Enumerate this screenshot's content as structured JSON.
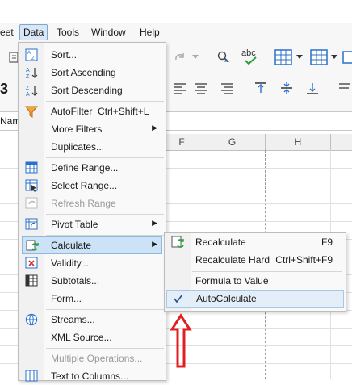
{
  "menubar": {
    "items": [
      {
        "label": "eet"
      },
      {
        "label": "Data"
      },
      {
        "label": "Tools"
      },
      {
        "label": "Window"
      },
      {
        "label": "Help"
      }
    ]
  },
  "namebox": {
    "label": "Nam"
  },
  "toolbar": {
    "digit": "3"
  },
  "columns": [
    "F",
    "G",
    "H"
  ],
  "data_menu": {
    "items": [
      {
        "label": "Sort...",
        "icon": "sort-icon"
      },
      {
        "label": "Sort Ascending",
        "icon": "sort-ascending-icon"
      },
      {
        "label": "Sort Descending",
        "icon": "sort-descending-icon"
      },
      {
        "label": "AutoFilter",
        "shortcut": "Ctrl+Shift+L",
        "icon": "autofilter-icon"
      },
      {
        "label": "More Filters",
        "icon": ""
      },
      {
        "label": "Duplicates...",
        "icon": ""
      },
      {
        "label": "Define Range...",
        "icon": "define-range-icon"
      },
      {
        "label": "Select Range...",
        "icon": "select-range-icon"
      },
      {
        "label": "Refresh Range",
        "icon": "refresh-range-icon",
        "disabled": true
      },
      {
        "label": "Pivot Table",
        "icon": "pivot-table-icon"
      },
      {
        "label": "Calculate",
        "icon": "calculate-icon"
      },
      {
        "label": "Validity...",
        "icon": "validity-icon"
      },
      {
        "label": "Subtotals...",
        "icon": "subtotals-icon"
      },
      {
        "label": "Form...",
        "icon": ""
      },
      {
        "label": "Streams...",
        "icon": "streams-icon"
      },
      {
        "label": "XML Source...",
        "icon": ""
      },
      {
        "label": "Multiple Operations...",
        "icon": "",
        "disabled": true
      },
      {
        "label": "Text to Columns...",
        "icon": "text-to-columns-icon"
      }
    ]
  },
  "calculate_submenu": {
    "items": [
      {
        "label": "Recalculate",
        "shortcut": "F9"
      },
      {
        "label": "Recalculate Hard",
        "shortcut": "Ctrl+Shift+F9"
      },
      {
        "label": "Formula to Value",
        "shortcut": ""
      },
      {
        "label": "AutoCalculate",
        "shortcut": "",
        "checked": true
      }
    ]
  },
  "annotation": {
    "color": "#e02020"
  }
}
